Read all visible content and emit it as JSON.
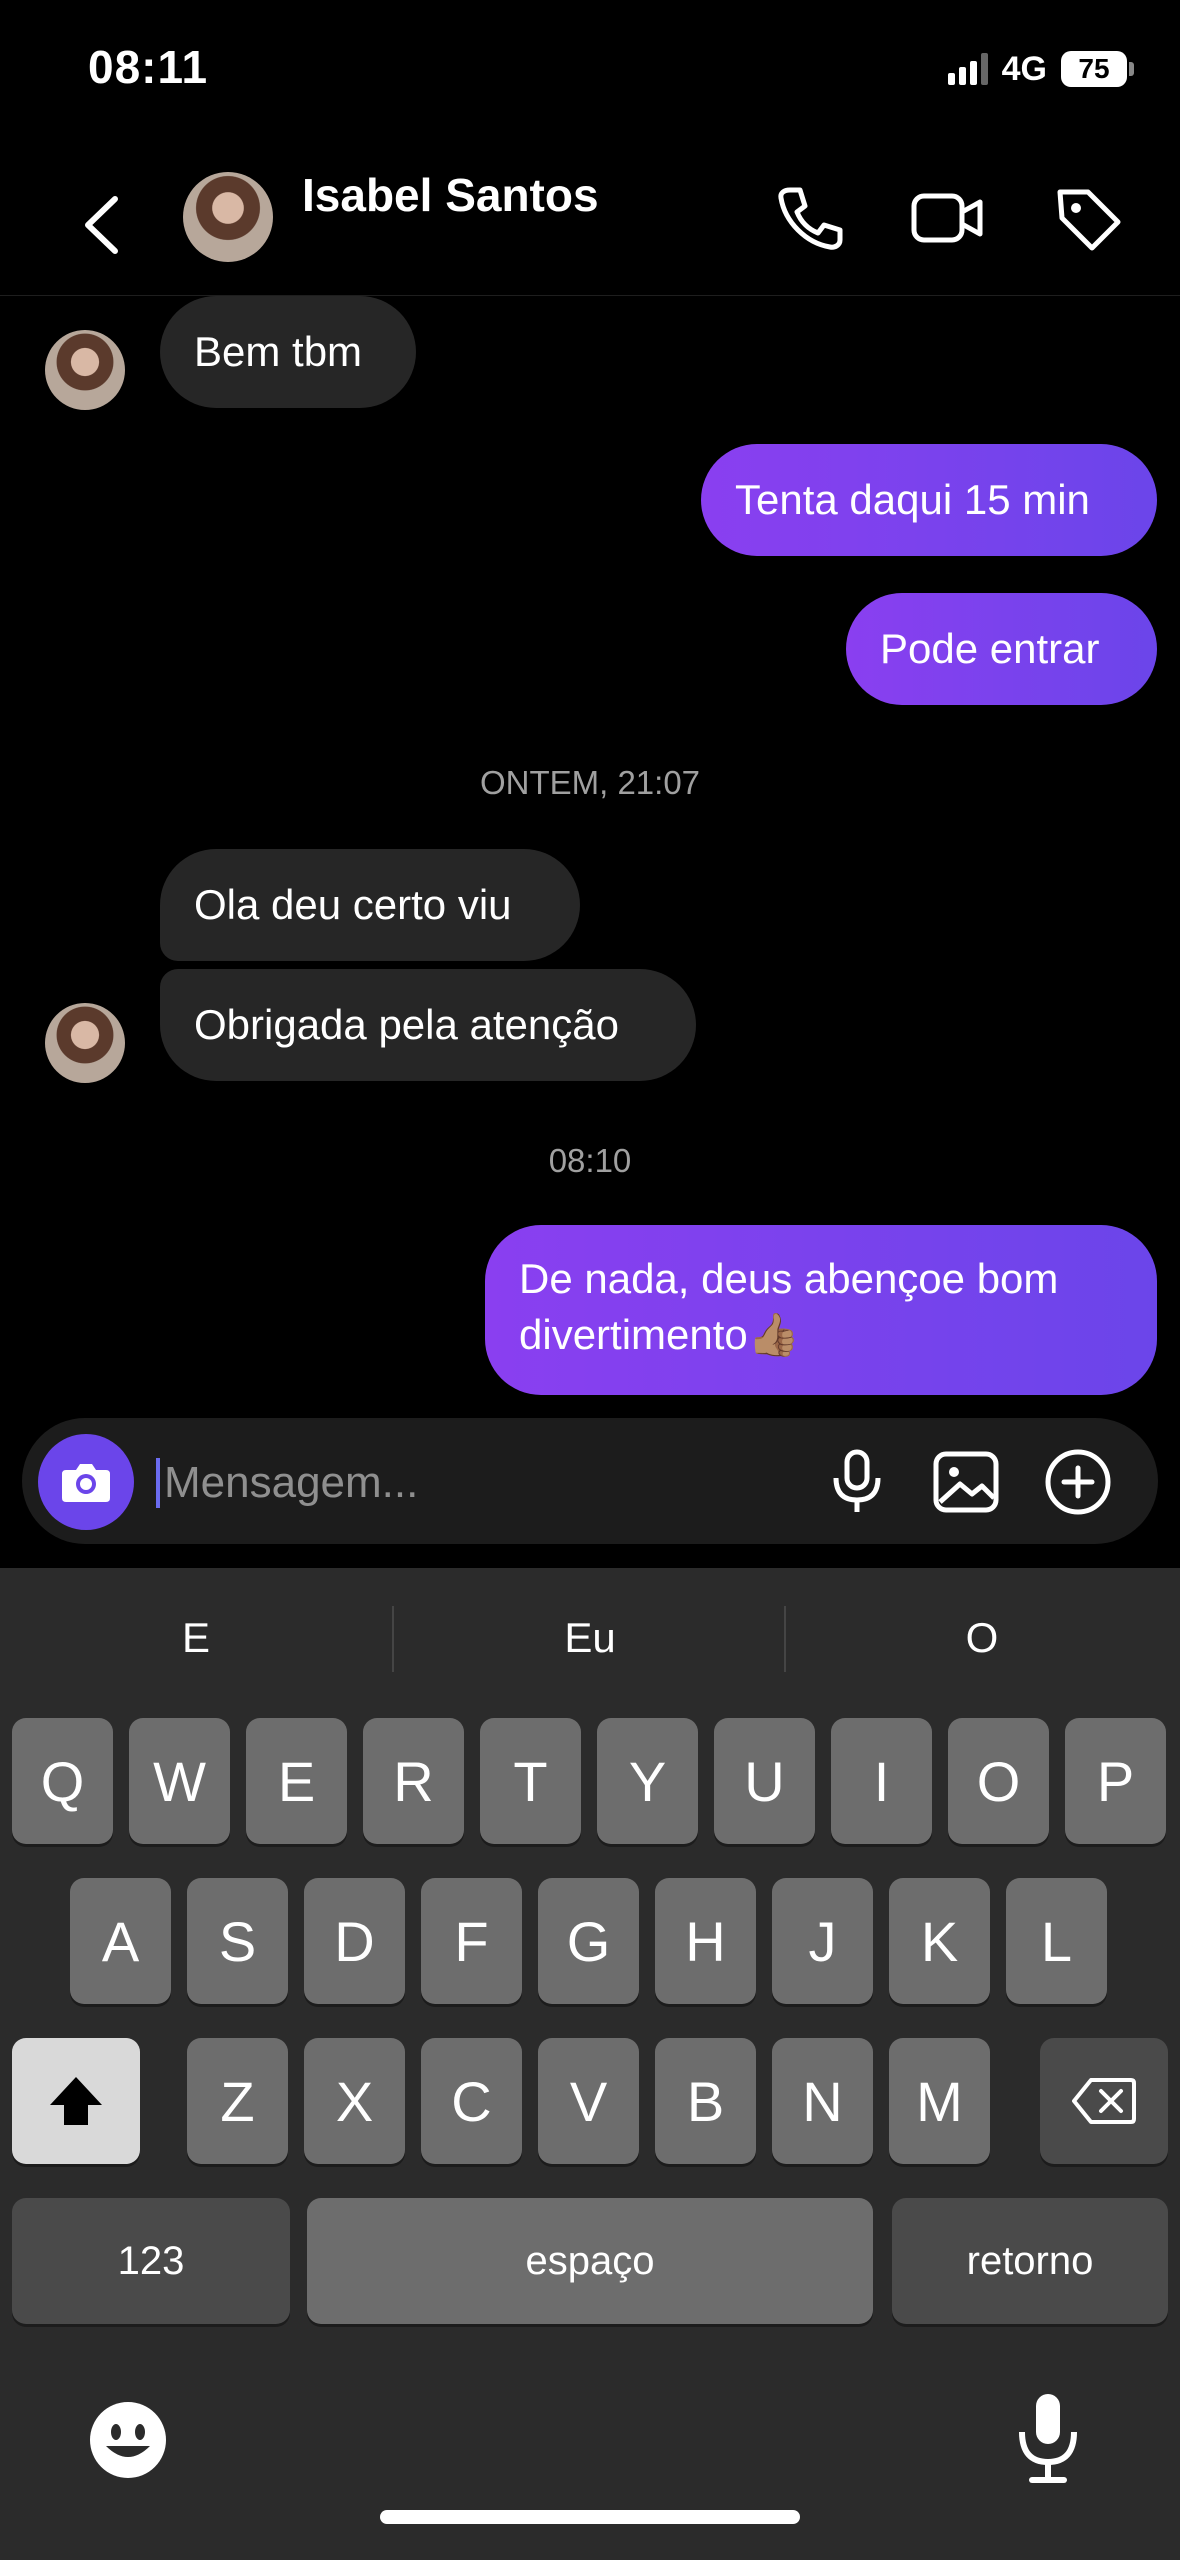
{
  "status_bar": {
    "time": "08:11",
    "network": "4G",
    "battery": "75"
  },
  "header": {
    "contact_name": "Isabel Santos"
  },
  "messages": {
    "m1": "Bem tbm",
    "m2": "Tenta daqui 15 min",
    "m3": "Pode entrar",
    "ts1": "ONTEM, 21:07",
    "m4": "Ola deu certo viu",
    "m5": "Obrigada pela atenção",
    "ts2": "08:10",
    "m6_line1": "De nada, deus abençoe bom",
    "m6_line2": "divertimento👍🏽"
  },
  "composer": {
    "placeholder": "Mensagem..."
  },
  "keyboard": {
    "suggestions": [
      "E",
      "Eu",
      "O"
    ],
    "row1": [
      "Q",
      "W",
      "E",
      "R",
      "T",
      "Y",
      "U",
      "I",
      "O",
      "P"
    ],
    "row2": [
      "A",
      "S",
      "D",
      "F",
      "G",
      "H",
      "J",
      "K",
      "L"
    ],
    "row3": [
      "Z",
      "X",
      "C",
      "V",
      "B",
      "N",
      "M"
    ],
    "numbers_label": "123",
    "space_label": "espaço",
    "return_label": "retorno"
  },
  "colors": {
    "accent": "#6b45ea",
    "outgoing_bubble": "#8a3ff0",
    "incoming_bubble": "#262626"
  }
}
